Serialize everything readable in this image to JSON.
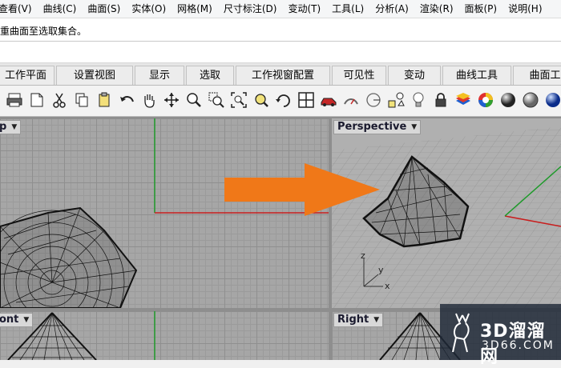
{
  "menu": [
    "查看(V)",
    "曲线(C)",
    "曲面(S)",
    "实体(O)",
    "网格(M)",
    "尺寸标注(D)",
    "变动(T)",
    "工具(L)",
    "分析(A)",
    "渲染(R)",
    "面板(P)",
    "说明(H)"
  ],
  "command_prompt": "重曲面至选取集合。",
  "tabs": [
    "工作平面",
    "设置视图",
    "显示",
    "选取",
    "工作视窗配置",
    "可见性",
    "变动",
    "曲线工具",
    "曲面工"
  ],
  "toolbar_icons": [
    "print-icon",
    "open-file-icon",
    "cut-icon",
    "copy-icon",
    "paste-icon",
    "undo-icon",
    "pan-hand-icon",
    "rotate-view-icon",
    "zoom-icon",
    "zoom-window-icon",
    "zoom-extents-icon",
    "zoom-selected-icon",
    "rotate-icon",
    "four-viewports-icon",
    "car-icon",
    "analyze-icon",
    "circle-icon",
    "shapes-icon",
    "light-bulb-icon",
    "lock-icon",
    "layer-color-icon",
    "color-wheel-icon",
    "sphere-dark-icon",
    "sphere-gray-icon",
    "sphere-shaded-icon",
    "sphere-blue-icon"
  ],
  "viewports": {
    "top": "p",
    "perspective": "Perspective",
    "front": "ont",
    "right": "Right"
  },
  "axes": {
    "z": "z",
    "y": "y",
    "x": "x"
  },
  "watermark": {
    "main": "3D溜溜网",
    "sub": "3D66.COM"
  },
  "colors": {
    "arrow": "#f07818",
    "x_axis": "#c81e1e",
    "y_axis": "#1e9a2a"
  }
}
